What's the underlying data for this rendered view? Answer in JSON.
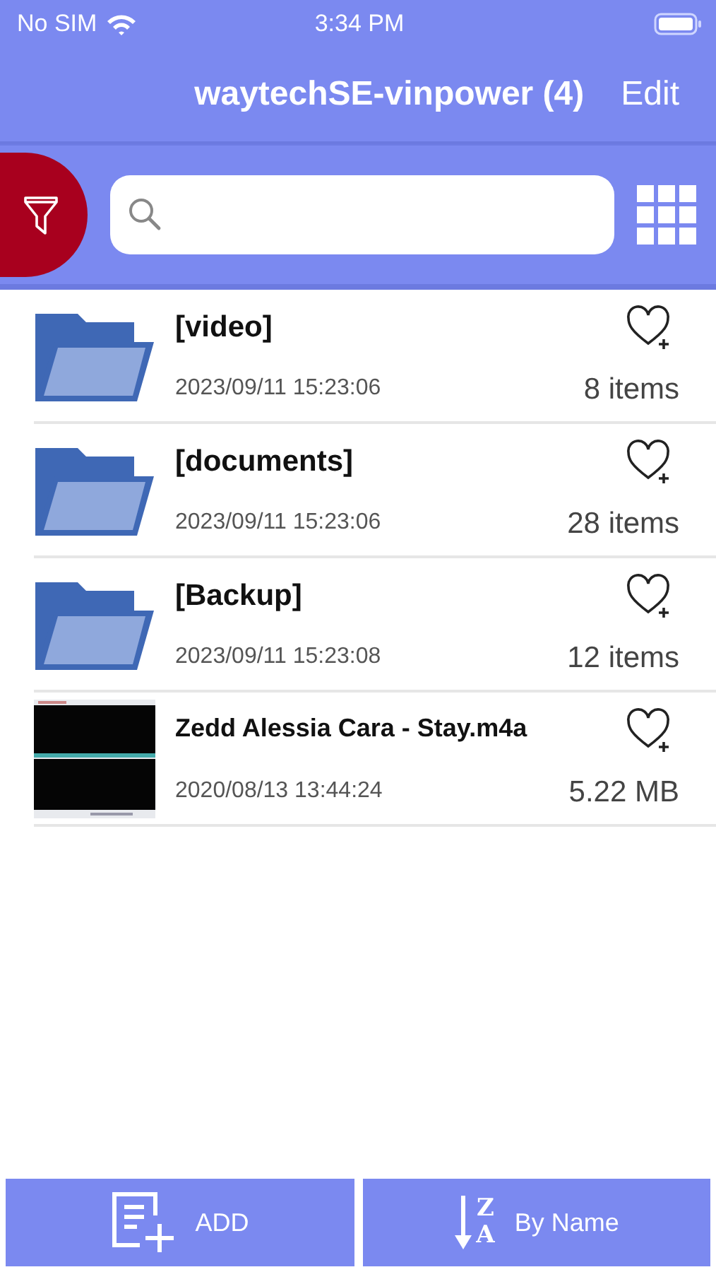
{
  "status_bar": {
    "carrier": "No SIM",
    "time": "3:34 PM"
  },
  "nav_bar": {
    "title": "waytechSE-vinpower (4)",
    "edit": "Edit"
  },
  "items": [
    {
      "kind": "folder",
      "name": "[video]",
      "date": "2023/09/11 15:23:06",
      "info": "8 items"
    },
    {
      "kind": "folder",
      "name": "[documents]",
      "date": "2023/09/11 15:23:06",
      "info": "28 items"
    },
    {
      "kind": "folder",
      "name": "[Backup]",
      "date": "2023/09/11 15:23:08",
      "info": "12 items"
    },
    {
      "kind": "file",
      "name": "Zedd Alessia Cara - Stay.m4a",
      "date": "2020/08/13 13:44:24",
      "info": "5.22 MB"
    }
  ],
  "toolbar": {
    "add": "ADD",
    "sort": {
      "letters": [
        "Z",
        "A"
      ],
      "label": "By Name"
    }
  }
}
